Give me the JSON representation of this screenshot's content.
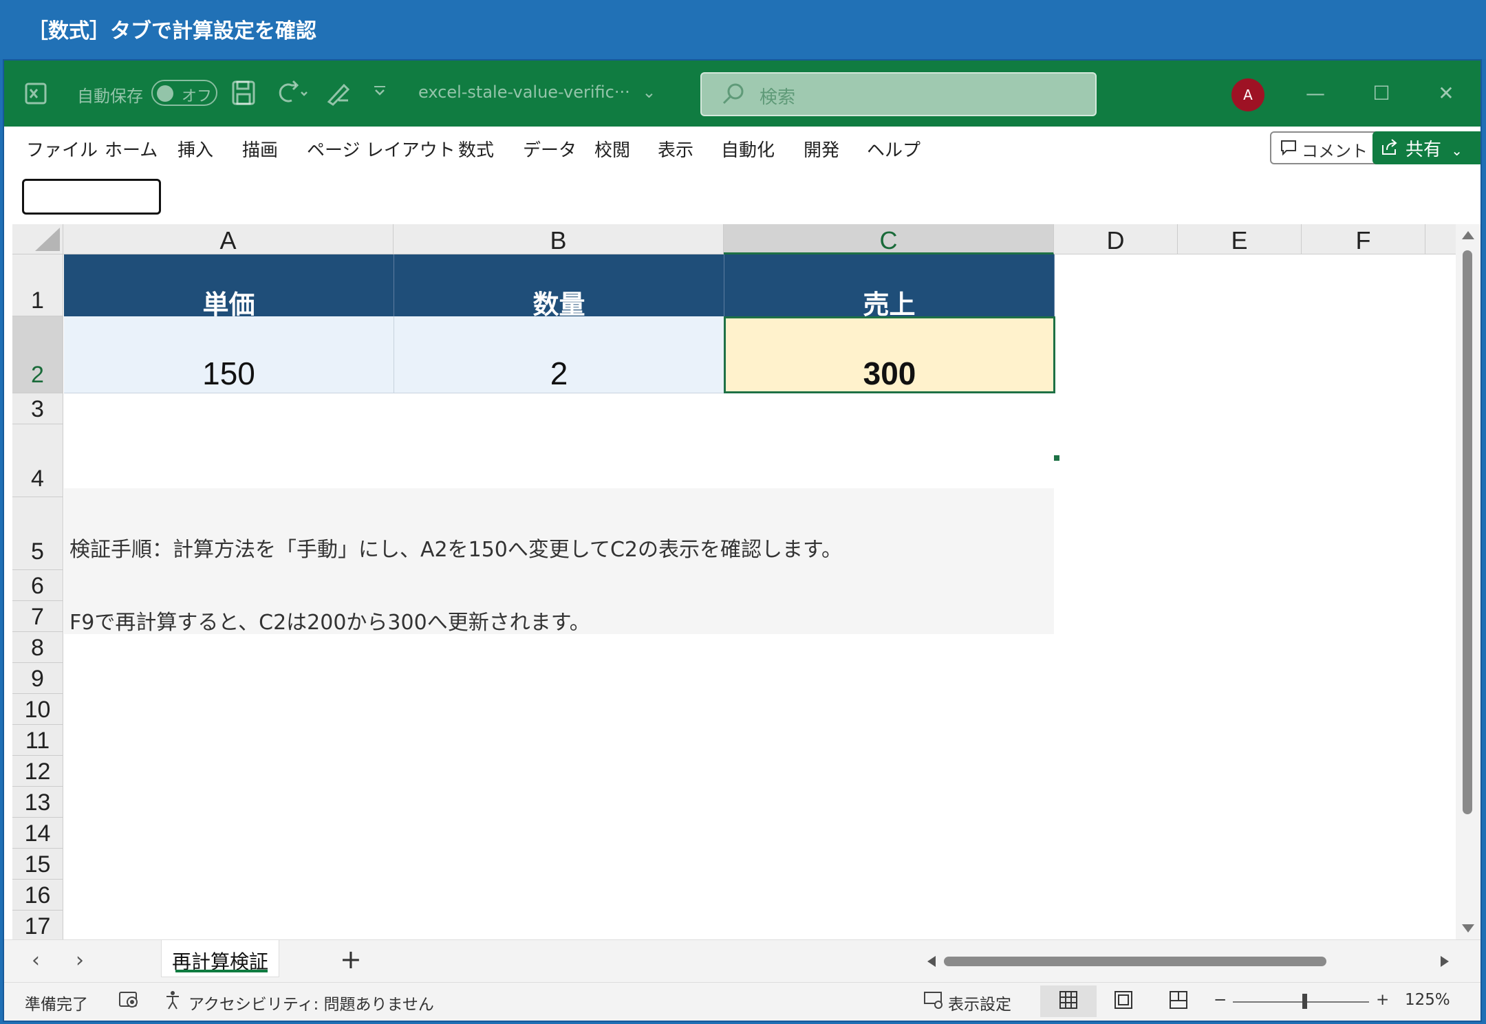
{
  "banner": {
    "title": "［数式］タブで計算設定を確認"
  },
  "titlebar": {
    "autosave_label": "自動保存",
    "autosave_state": "オフ",
    "filename": "excel-stale-value-verific···",
    "search_placeholder": "検索",
    "avatar_initial": "A"
  },
  "menu": {
    "items": [
      "ファイル",
      "ホーム",
      "挿入",
      "描画",
      "ページ レイアウト",
      "数式",
      "データ",
      "校閲",
      "表示",
      "自動化",
      "開発",
      "ヘルプ"
    ],
    "comment_label": "コメント",
    "share_label": "共有"
  },
  "grid": {
    "columns": [
      "A",
      "B",
      "C",
      "D",
      "E",
      "F"
    ],
    "selected_column": "C",
    "rows": [
      "1",
      "2",
      "3",
      "4",
      "5",
      "6",
      "7",
      "8",
      "9",
      "10",
      "11",
      "12",
      "13",
      "14",
      "15",
      "16",
      "17"
    ],
    "selected_row": "2",
    "headers": [
      "単価",
      "数量",
      "売上"
    ],
    "values": [
      "150",
      "2",
      "300"
    ],
    "note_row4": "検証手順：計算方法を「手動」にし、A2を150へ変更してC2の表示を確認します。",
    "note_row5": "F9で再計算すると、C2は200から300へ更新されます。"
  },
  "sheets": {
    "active_tab": "再計算検証",
    "add_label": "+"
  },
  "status": {
    "ready": "準備完了",
    "accessibility": "アクセシビリティ: 問題ありません",
    "display_settings": "表示設定",
    "zoom": "125%",
    "zoom_minus": "−",
    "zoom_plus": "+"
  },
  "colors": {
    "excel_green": "#107c41",
    "header_fill": "#1f4e79",
    "value_fill": "#eaf2fa",
    "selected_fill": "#fff2cc",
    "banner_blue": "#2171b6"
  }
}
